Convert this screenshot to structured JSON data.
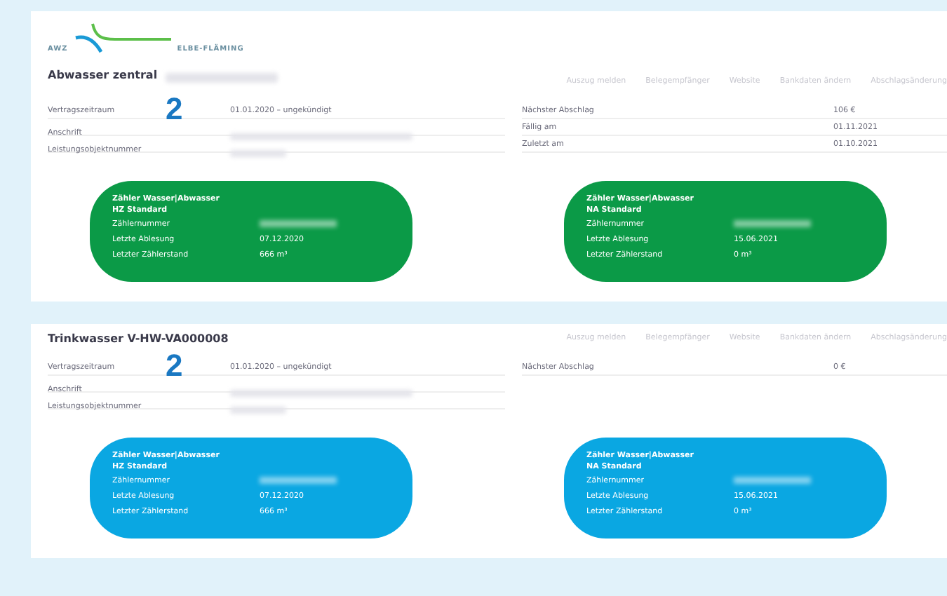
{
  "logo": {
    "left": "AWZ",
    "right": "ELBE-FLÄMING"
  },
  "sections": [
    {
      "title": "Abwasser zentral",
      "title_redacted": true,
      "marker": "2",
      "show_logo": true,
      "nav": [
        "Auszug melden",
        "Belegempfänger",
        "Website",
        "Bankdaten ändern",
        "Abschlagsänderung"
      ],
      "left_rows": [
        {
          "label": "Vertragszeitraum",
          "value": "01.01.2020 – ungekündigt"
        },
        {
          "label": "Anschrift",
          "redacted": true
        },
        {
          "label": "Leistungsobjektnummer",
          "redacted": true
        }
      ],
      "right_rows": [
        {
          "label": "Nächster Abschlag",
          "value": "106 €"
        },
        {
          "label": "Fällig am",
          "value": "01.11.2021"
        },
        {
          "label": "Zuletzt am",
          "value": "01.10.2021"
        }
      ],
      "cards": [
        {
          "color": "#0b9a47",
          "title": "Zähler Wasser|Abwasser",
          "subtitle": "HZ Standard",
          "rows": [
            {
              "label": "Zählernummer",
              "redacted": true
            },
            {
              "label": "Letzte Ablesung",
              "value": "07.12.2020"
            },
            {
              "label": "Letzter Zählerstand",
              "value": "666 m³"
            }
          ]
        },
        {
          "color": "#0b9a47",
          "title": "Zähler Wasser|Abwasser",
          "subtitle": "NA Standard",
          "rows": [
            {
              "label": "Zählernummer",
              "redacted": true
            },
            {
              "label": "Letzte Ablesung",
              "value": "15.06.2021"
            },
            {
              "label": "Letzter Zählerstand",
              "value": "0 m³"
            }
          ]
        }
      ]
    },
    {
      "title": "Trinkwasser V-HW-VA000008",
      "marker": "2",
      "nav": [
        "Auszug melden",
        "Belegempfänger",
        "Website",
        "Bankdaten ändern",
        "Abschlagsänderung"
      ],
      "left_rows": [
        {
          "label": "Vertragszeitraum",
          "value": "01.01.2020 – ungekündigt"
        },
        {
          "label": "Anschrift",
          "redacted": true
        },
        {
          "label": "Leistungsobjektnummer",
          "redacted": true
        }
      ],
      "right_rows": [
        {
          "label": "Nächster Abschlag",
          "value": "0 €"
        }
      ],
      "cards": [
        {
          "color": "#0aa7e2",
          "title": "Zähler Wasser|Abwasser",
          "subtitle": "HZ Standard",
          "rows": [
            {
              "label": "Zählernummer",
              "redacted": true
            },
            {
              "label": "Letzte Ablesung",
              "value": "07.12.2020"
            },
            {
              "label": "Letzter Zählerstand",
              "value": "666 m³"
            }
          ]
        },
        {
          "color": "#0aa7e2",
          "title": "Zähler Wasser|Abwasser",
          "subtitle": "NA Standard",
          "rows": [
            {
              "label": "Zählernummer",
              "redacted": true
            },
            {
              "label": "Letzte Ablesung",
              "value": "15.06.2021"
            },
            {
              "label": "Letzter Zählerstand",
              "value": "0 m³"
            }
          ]
        }
      ]
    }
  ]
}
